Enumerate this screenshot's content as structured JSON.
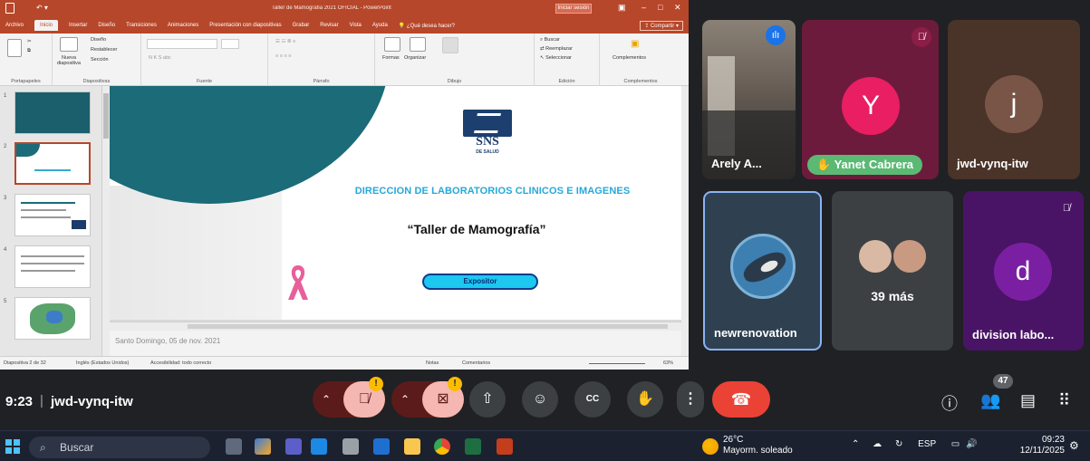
{
  "ppt": {
    "title": "Taller de Mamografia 2021 OFICIAL - PowerPoint",
    "signin": "Iniciar sesión",
    "tabs": [
      "Archivo",
      "Inicio",
      "Insertar",
      "Diseño",
      "Transiciones",
      "Animaciones",
      "Presentación con diapositivas",
      "Grabar",
      "Revisar",
      "Vista",
      "Ayuda",
      "¿Qué desea hacer?"
    ],
    "share": "Compartir",
    "ribbon": {
      "groups": [
        "Portapapeles",
        "Diapositivas",
        "Fuente",
        "Párrafo",
        "Dibujo",
        "Edición",
        "Complementos"
      ],
      "nueva": "Nueva diapositiva",
      "diseno": "Diseño",
      "restablecer": "Restablecer",
      "seccion": "Sección",
      "formas": "Formas",
      "organizar": "Organizar",
      "buscar": "Buscar",
      "reemplazar": "Reemplazar",
      "seleccionar": "Seleccionar",
      "complementos": "Complementos"
    },
    "thumb_numbers": [
      "1",
      "2",
      "3",
      "4",
      "5"
    ],
    "slide": {
      "logo": "SNS",
      "logo_sub": "DE SALUD",
      "heading": "DIRECCION DE LABORATORIOS CLINICOS E IMAGENES",
      "title": "“Taller de Mamografía”",
      "button": "Expositor"
    },
    "notes": "Santo Domingo, 05 de nov. 2021",
    "status": {
      "slide": "Diapositiva 2 de 32",
      "lang": "Inglés (Estados Unidos)",
      "access": "Accesibilidad: todo correcto",
      "notas": "Notas",
      "comentarios": "Comentarios",
      "zoom": "63%"
    }
  },
  "participants": [
    {
      "name": "Arely A...",
      "type": "video"
    },
    {
      "name": "Yanet Cabrera",
      "initial": "Y",
      "color": "#e91e63",
      "bg": "#6d1b3c",
      "hand_raised": true
    },
    {
      "name": "jwd-vynq-itw",
      "initial": "j",
      "color": "#795548",
      "bg": "#4a3328"
    },
    {
      "name": "newrenovation",
      "type": "avatar-image",
      "bg": "#2f4150"
    },
    {
      "more_count": "39 más",
      "bg": "#3c4043"
    },
    {
      "name": "division labo...",
      "initial": "d",
      "color": "#7b1fa2",
      "bg": "#4a1466"
    }
  ],
  "meet": {
    "time": "9:23",
    "code": "jwd-vynq-itw",
    "people_count": "47",
    "warning": "!"
  },
  "taskbar": {
    "search": "Buscar",
    "temp": "26°C",
    "weather": "Mayorm. soleado",
    "lang": "ESP",
    "time": "09:23",
    "date": "12/11/2025"
  }
}
